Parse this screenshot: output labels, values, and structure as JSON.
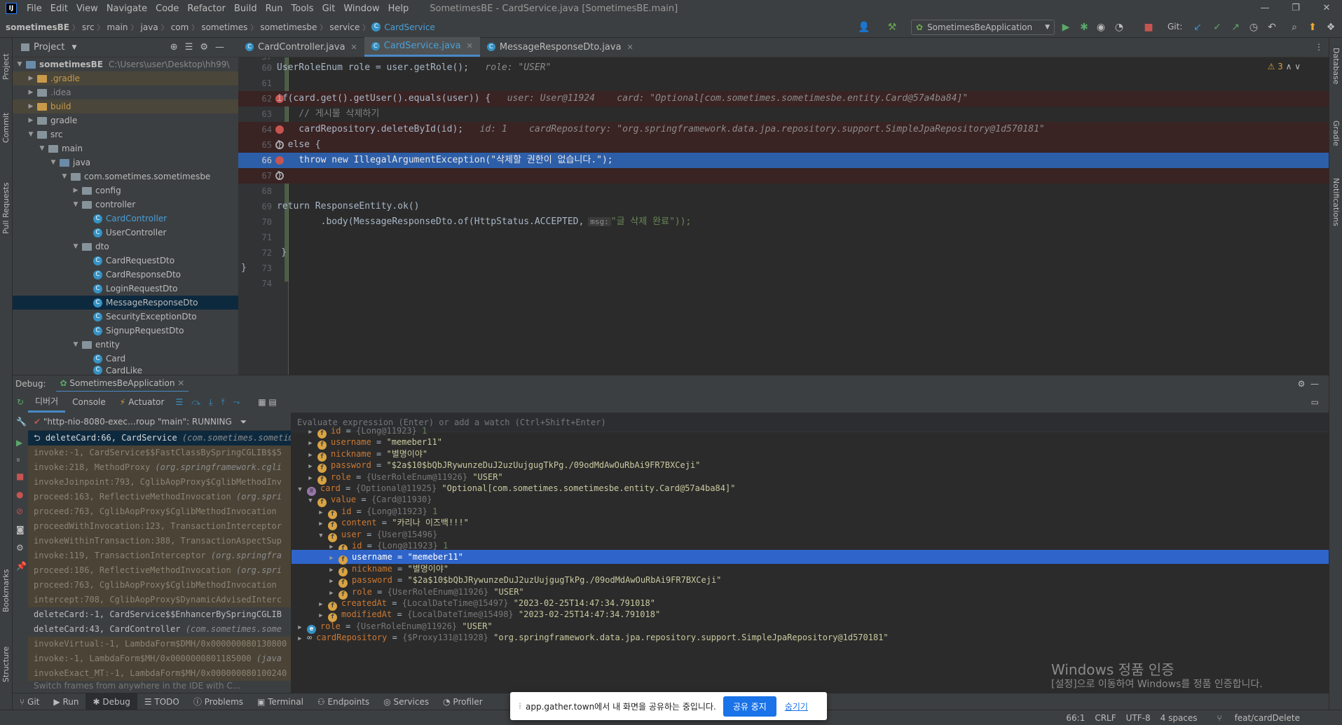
{
  "menubar": {
    "items": [
      "File",
      "Edit",
      "View",
      "Navigate",
      "Code",
      "Refactor",
      "Build",
      "Run",
      "Tools",
      "Git",
      "Window",
      "Help"
    ],
    "window_title": "SometimesBE - CardService.java [SometimesBE.main]",
    "logo": "IJ"
  },
  "breadcrumb": [
    "sometimesBE",
    "src",
    "main",
    "java",
    "com",
    "sometimes",
    "sometimesbe",
    "service",
    "CardService"
  ],
  "toolbar": {
    "run_config": "SometimesBeApplication",
    "git_label": "Git:"
  },
  "left_strip": {
    "labels": [
      "Project",
      "Commit",
      "Pull Requests",
      "Bookmarks",
      "Structure"
    ]
  },
  "right_strip": {
    "labels": [
      "Database",
      "Gradle",
      "Notifications"
    ]
  },
  "project": {
    "title": "Project",
    "root_name": "sometimesBE",
    "root_path": "C:\\Users\\user\\Desktop\\hh99\\",
    "items": [
      ".gradle",
      ".idea",
      "build",
      "gradle",
      "src",
      "main",
      "java",
      "com.sometimes.sometimesbe",
      "config",
      "controller",
      "CardController",
      "UserController",
      "dto",
      "CardRequestDto",
      "CardResponseDto",
      "LoginRequestDto",
      "MessageResponseDto",
      "SecurityExceptionDto",
      "SignupRequestDto",
      "entity",
      "Card",
      "CardLike"
    ]
  },
  "tabs": [
    "CardController.java",
    "CardService.java",
    "MessageResponseDto.java"
  ],
  "editor": {
    "warnings": "3",
    "lines": [
      {
        "n": "57",
        "code": ""
      },
      {
        "n": "60",
        "code": "UserRoleEnum role = user.getRole();",
        "hint": "role: \"USER\""
      },
      {
        "n": "61",
        "code": ""
      },
      {
        "n": "62",
        "code": "if(card.get().getUser().equals(user)) {",
        "hint": "user: User@11924    card: \"Optional[com.sometimes.sometimesbe.entity.Card@57a4ba84]\""
      },
      {
        "n": "63",
        "code": "    // 게시물 삭제하기"
      },
      {
        "n": "64",
        "code": "    cardRepository.deleteById(id);",
        "hint": "id: 1    cardRepository: \"org.springframework.data.jpa.repository.support.SimpleJpaRepository@1d570181\""
      },
      {
        "n": "65",
        "code": "} else {"
      },
      {
        "n": "66",
        "code": "    throw new IllegalArgumentException(\"삭제할 권한이 없습니다.\");"
      },
      {
        "n": "67",
        "code": "}"
      },
      {
        "n": "68",
        "code": ""
      },
      {
        "n": "69",
        "code": "return ResponseEntity.ok()"
      },
      {
        "n": "70",
        "code": "        .body(MessageResponseDto.of(HttpStatus.ACCEPTED,",
        "param": "msg:",
        "tail": "\"글 삭제 완료\"));"
      },
      {
        "n": "71",
        "code": ""
      },
      {
        "n": "72",
        "code": "    }"
      },
      {
        "n": "73",
        "code": "}"
      },
      {
        "n": "74",
        "code": ""
      }
    ]
  },
  "debug": {
    "label": "Debug:",
    "session": "SometimesBeApplication",
    "tabs": [
      "디버거",
      "Console",
      "Actuator"
    ],
    "thread": "\"http-nio-8080-exec…roup \"main\": RUNNING",
    "eval_placeholder": "Evaluate expression (Enter) or add a watch (Ctrl+Shift+Enter)",
    "frames": [
      {
        "m": "deleteCard:66, CardService",
        "c": "(com.sometimes.sometim"
      },
      {
        "m": "invoke:-1, CardService$$FastClassBySpringCGLIB$$5",
        "c": ""
      },
      {
        "m": "invoke:218, MethodProxy",
        "c": "(org.springframework.cgli"
      },
      {
        "m": "invokeJoinpoint:793, CglibAopProxy$CglibMethodInv",
        "c": ""
      },
      {
        "m": "proceed:163, ReflectiveMethodInvocation",
        "c": "(org.spri"
      },
      {
        "m": "proceed:763, CglibAopProxy$CglibMethodInvocation",
        "c": ""
      },
      {
        "m": "proceedWithInvocation:123, TransactionInterceptor",
        "c": ""
      },
      {
        "m": "invokeWithinTransaction:388, TransactionAspectSup",
        "c": ""
      },
      {
        "m": "invoke:119, TransactionInterceptor",
        "c": "(org.springfra"
      },
      {
        "m": "proceed:186, ReflectiveMethodInvocation",
        "c": "(org.spri"
      },
      {
        "m": "proceed:763, CglibAopProxy$CglibMethodInvocation",
        "c": ""
      },
      {
        "m": "intercept:708, CglibAopProxy$DynamicAdvisedInterc",
        "c": ""
      },
      {
        "m": "deleteCard:-1, CardService$$EnhancerBySpringCGLIB",
        "c": ""
      },
      {
        "m": "deleteCard:43, CardController",
        "c": "(com.sometimes.some"
      },
      {
        "m": "invokeVirtual:-1, LambdaForm$DMH/0x000000080130800",
        "c": ""
      },
      {
        "m": "invoke:-1, LambdaForm$MH/0x0000000801185000",
        "c": "(java"
      },
      {
        "m": "invokeExact_MT:-1, LambdaForm$MH/0x000000080100240",
        "c": ""
      }
    ],
    "frames_hint": "Switch frames from anywhere in the IDE with C...",
    "vars": [
      {
        "d": 1,
        "icon": "f",
        "n": "id",
        "t": "{Long@11923}",
        "v": "1"
      },
      {
        "d": 1,
        "icon": "f",
        "n": "username",
        "t": "",
        "v": "\"memeber11\""
      },
      {
        "d": 1,
        "icon": "f",
        "n": "nickname",
        "t": "",
        "v": "\"별명이야\""
      },
      {
        "d": 1,
        "icon": "f",
        "n": "password",
        "t": "",
        "v": "\"$2a$10$bQbJRywunzeDuJ2uzUujgugTkPg./09odMdAwOuRbAi9FR7BXCeji\""
      },
      {
        "d": 1,
        "icon": "f",
        "n": "role",
        "t": "{UserRoleEnum@11926}",
        "v": "\"USER\""
      },
      {
        "d": 0,
        "icon": "l",
        "n": "card",
        "t": "{Optional@11925}",
        "v": "\"Optional[com.sometimes.sometimesbe.entity.Card@57a4ba84]\"",
        "open": true
      },
      {
        "d": 1,
        "icon": "f",
        "n": "value",
        "t": "{Card@11930}",
        "v": "",
        "open": true
      },
      {
        "d": 2,
        "icon": "f",
        "n": "id",
        "t": "{Long@11923}",
        "v": "1"
      },
      {
        "d": 2,
        "icon": "f",
        "n": "content",
        "t": "",
        "v": "\"카리나 이즈백!!!\""
      },
      {
        "d": 2,
        "icon": "f",
        "n": "user",
        "t": "{User@15496}",
        "v": "",
        "open": true
      },
      {
        "d": 3,
        "icon": "f",
        "n": "id",
        "t": "{Long@11923}",
        "v": "1"
      },
      {
        "d": 3,
        "icon": "f",
        "n": "username",
        "t": "",
        "v": "\"memeber11\"",
        "sel": true
      },
      {
        "d": 3,
        "icon": "f",
        "n": "nickname",
        "t": "",
        "v": "\"별명이야\""
      },
      {
        "d": 3,
        "icon": "f",
        "n": "password",
        "t": "",
        "v": "\"$2a$10$bQbJRywunzeDuJ2uzUujgugTkPg./09odMdAwOuRbAi9FR7BXCeji\""
      },
      {
        "d": 3,
        "icon": "f",
        "n": "role",
        "t": "{UserRoleEnum@11926}",
        "v": "\"USER\""
      },
      {
        "d": 2,
        "icon": "f",
        "n": "createdAt",
        "t": "{LocalDateTime@15497}",
        "v": "\"2023-02-25T14:47:34.791018\""
      },
      {
        "d": 2,
        "icon": "f",
        "n": "modifiedAt",
        "t": "{LocalDateTime@15498}",
        "v": "\"2023-02-25T14:47:34.791018\""
      },
      {
        "d": 0,
        "icon": "e",
        "n": "role",
        "t": "{UserRoleEnum@11926}",
        "v": "\"USER\""
      },
      {
        "d": 0,
        "icon": "oo",
        "n": "cardRepository",
        "t": "{$Proxy131@11928}",
        "v": "\"org.springframework.data.jpa.repository.support.SimpleJpaRepository@1d570181\""
      }
    ]
  },
  "tool_tabs": [
    "Git",
    "Run",
    "Debug",
    "TODO",
    "Problems",
    "Terminal",
    "Endpoints",
    "Services",
    "Profiler"
  ],
  "share_bar": {
    "text": "app.gather.town에서 내 화면을 공유하는 중입니다.",
    "stop": "공유 중지",
    "hide": "숨기기"
  },
  "watermark": {
    "title": "Windows 정품 인증",
    "subtitle": "[설정]으로 이동하여 Windows를 정품 인증합니다."
  },
  "statusbar": {
    "position": "66:1",
    "line_sep": "CRLF",
    "encoding": "UTF-8",
    "indent": "4 spaces",
    "branch": "feat/cardDelete"
  }
}
